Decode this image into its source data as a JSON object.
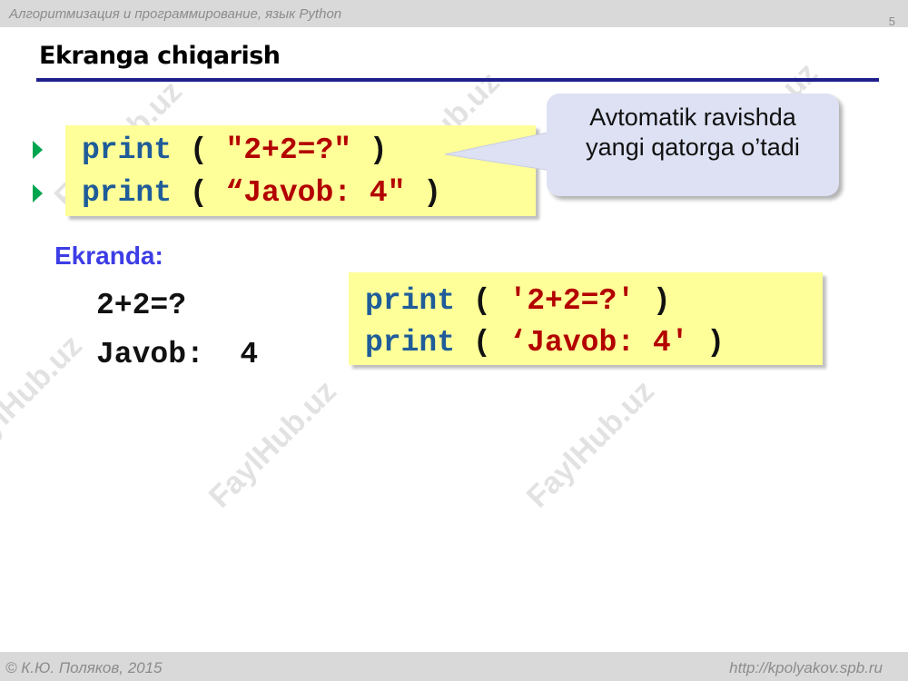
{
  "header": {
    "course_title": "Алгоритмизация и программирование, язык Python",
    "slide_number": "5"
  },
  "slide": {
    "title": "Ekranga chiqarish"
  },
  "code_block_1": {
    "line1": {
      "keyword": "print",
      "open": "( ",
      "string": "\"2+2=?\"",
      "close": " )"
    },
    "line2": {
      "keyword": "print",
      "open": "( ",
      "string": "“Javob: 4\"",
      "close": " )"
    }
  },
  "callout": {
    "line1": "Avtomatik ravishda",
    "line2": "yangi qatorga o’tadi"
  },
  "screen_output": {
    "label": "Ekranda:",
    "line1": "2+2=?",
    "line2": "Javob:  4"
  },
  "code_block_2": {
    "line1": {
      "keyword": "print",
      "open": "( ",
      "string": "'2+2=?'",
      "close": " )"
    },
    "line2": {
      "keyword": "print",
      "open": "( ",
      "string": "‘Javob: 4'",
      "close": " )"
    }
  },
  "footer": {
    "author": "© К.Ю. Поляков, 2015",
    "url": "http://kpolyakov.spb.ru"
  },
  "watermark": {
    "text": "FaylHub.uz"
  },
  "colors": {
    "keyword": "#1f5c99",
    "string": "#b30000",
    "code_background": "#ffff99",
    "callout_background": "#dde1f3",
    "label": "#3d3de6",
    "bullet": "#00a550",
    "title_rule": "#1f1f8c"
  }
}
